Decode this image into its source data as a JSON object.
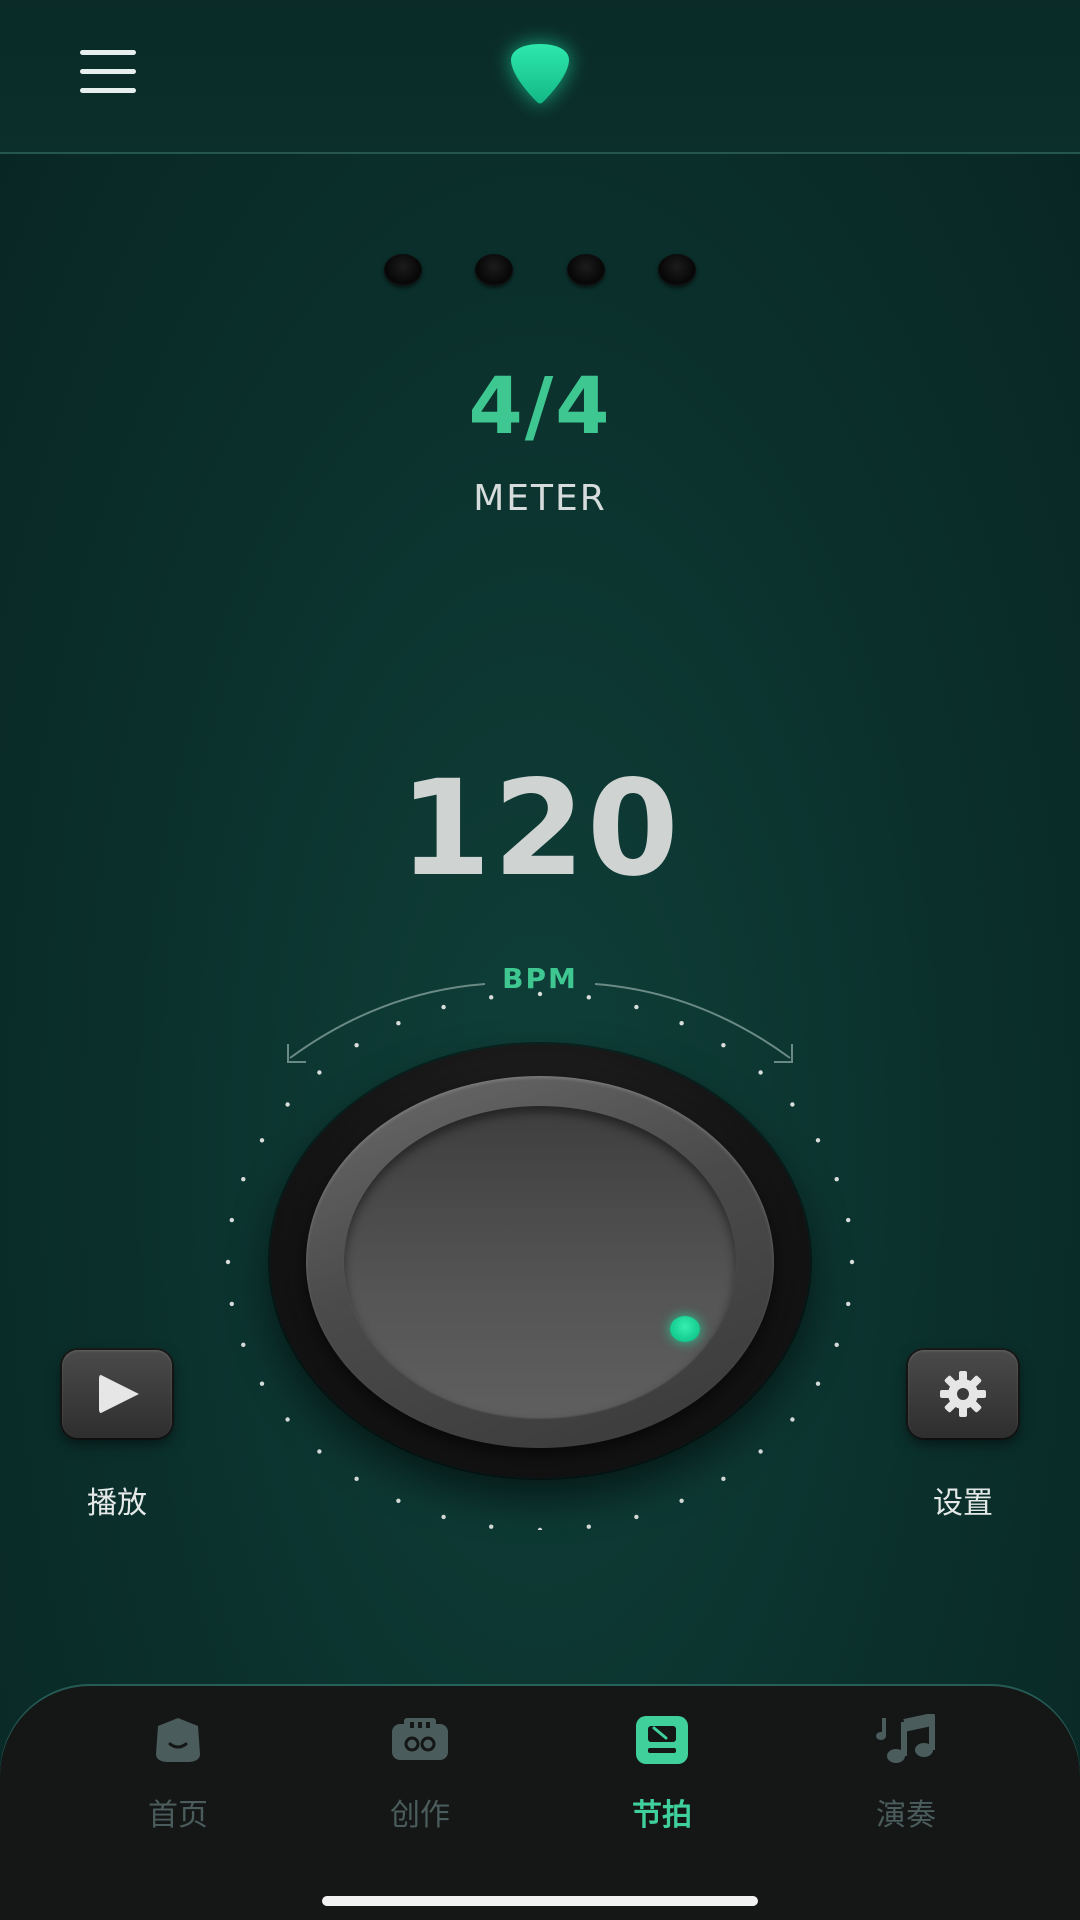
{
  "header": {
    "menu_icon": "hamburger-menu-icon",
    "logo_icon": "guitar-pick-icon",
    "logo_color": "#1ed79b"
  },
  "beat_indicator": {
    "count": 4
  },
  "meter": {
    "value": "4/4",
    "label": "METER",
    "accent_color": "#3fc792"
  },
  "tempo": {
    "value": "120",
    "unit_label": "BPM"
  },
  "controls": {
    "play": {
      "label": "播放",
      "icon": "play-icon"
    },
    "settings": {
      "label": "设置",
      "icon": "gear-icon"
    }
  },
  "bottom_nav": {
    "items": [
      {
        "label": "首页",
        "icon": "home-icon",
        "active": false
      },
      {
        "label": "创作",
        "icon": "create-icon",
        "active": false
      },
      {
        "label": "节拍",
        "icon": "metronome-icon",
        "active": true
      },
      {
        "label": "演奏",
        "icon": "music-note-icon",
        "active": false
      }
    ],
    "active_color": "#3fd09c",
    "inactive_color": "#4a5c5b"
  }
}
